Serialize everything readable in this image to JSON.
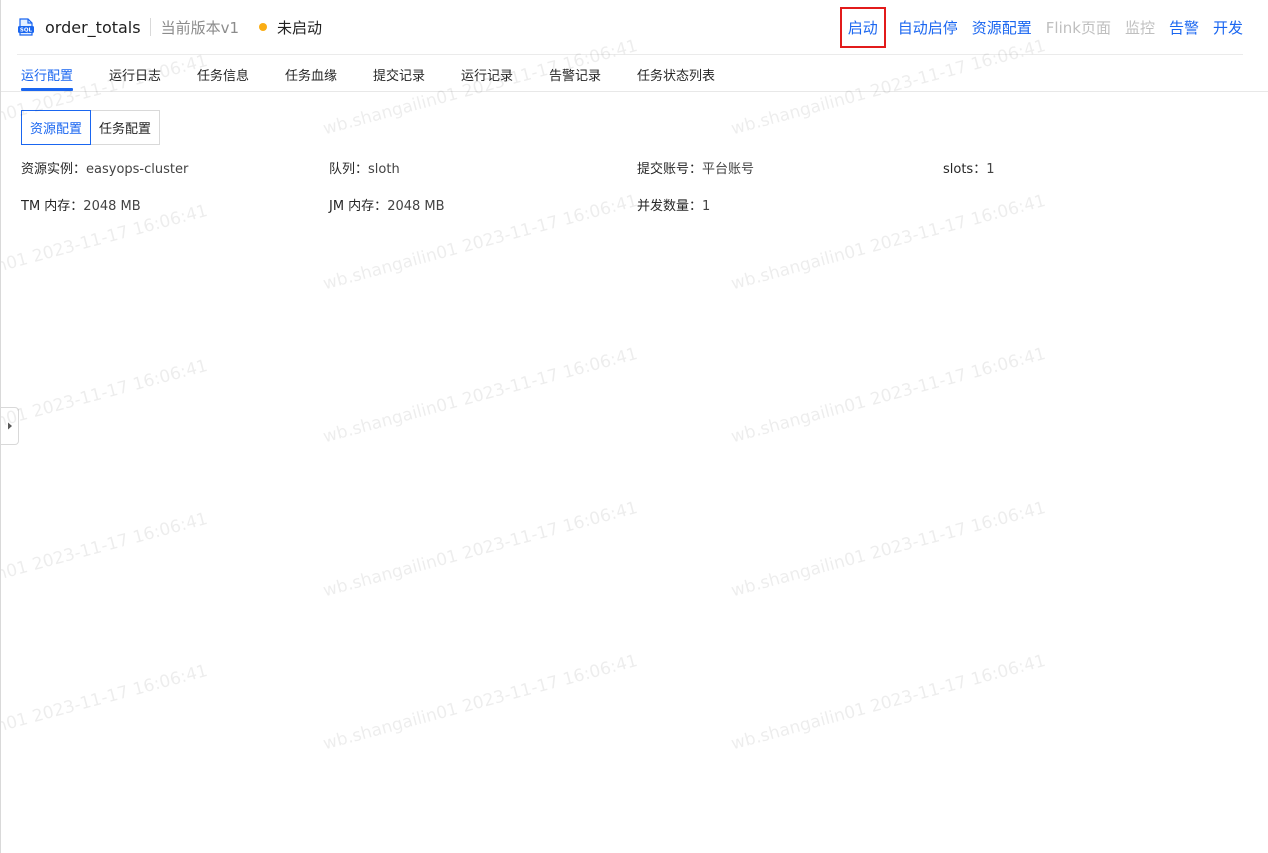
{
  "header": {
    "task_name": "order_totals",
    "version": "当前版本v1",
    "status": "未启动",
    "status_color": "#faad14",
    "icon": "sql-file-icon"
  },
  "actions": [
    {
      "label": "启动",
      "enabled": true,
      "highlighted": true
    },
    {
      "label": "自动启停",
      "enabled": true
    },
    {
      "label": "资源配置",
      "enabled": true
    },
    {
      "label": "Flink页面",
      "enabled": false
    },
    {
      "label": "监控",
      "enabled": false
    },
    {
      "label": "告警",
      "enabled": true
    },
    {
      "label": "开发",
      "enabled": true
    }
  ],
  "tabs": [
    {
      "label": "运行配置",
      "active": true
    },
    {
      "label": "运行日志"
    },
    {
      "label": "任务信息"
    },
    {
      "label": "任务血缘"
    },
    {
      "label": "提交记录"
    },
    {
      "label": "运行记录"
    },
    {
      "label": "告警记录"
    },
    {
      "label": "任务状态列表"
    }
  ],
  "subtabs": [
    {
      "label": "资源配置",
      "active": true
    },
    {
      "label": "任务配置"
    }
  ],
  "fields": {
    "resource_instance": {
      "label": "资源实例：",
      "value": "easyops-cluster"
    },
    "queue": {
      "label": "队列：",
      "value": "sloth"
    },
    "submit_account": {
      "label": "提交账号：",
      "value": "平台账号"
    },
    "slots": {
      "label": "slots：",
      "value": "1"
    },
    "tm_memory": {
      "label": "TM 内存：",
      "value": "2048 MB"
    },
    "jm_memory": {
      "label": "JM 内存：",
      "value": "2048 MB"
    },
    "parallelism": {
      "label": "并发数量：",
      "value": "1"
    }
  },
  "watermark_text": "wb.shangailin01 2023-11-17 16:06:41",
  "colors": {
    "accent": "#1a66f0",
    "disabled": "#bfbfbf",
    "highlight_box": "#e21b1b"
  }
}
